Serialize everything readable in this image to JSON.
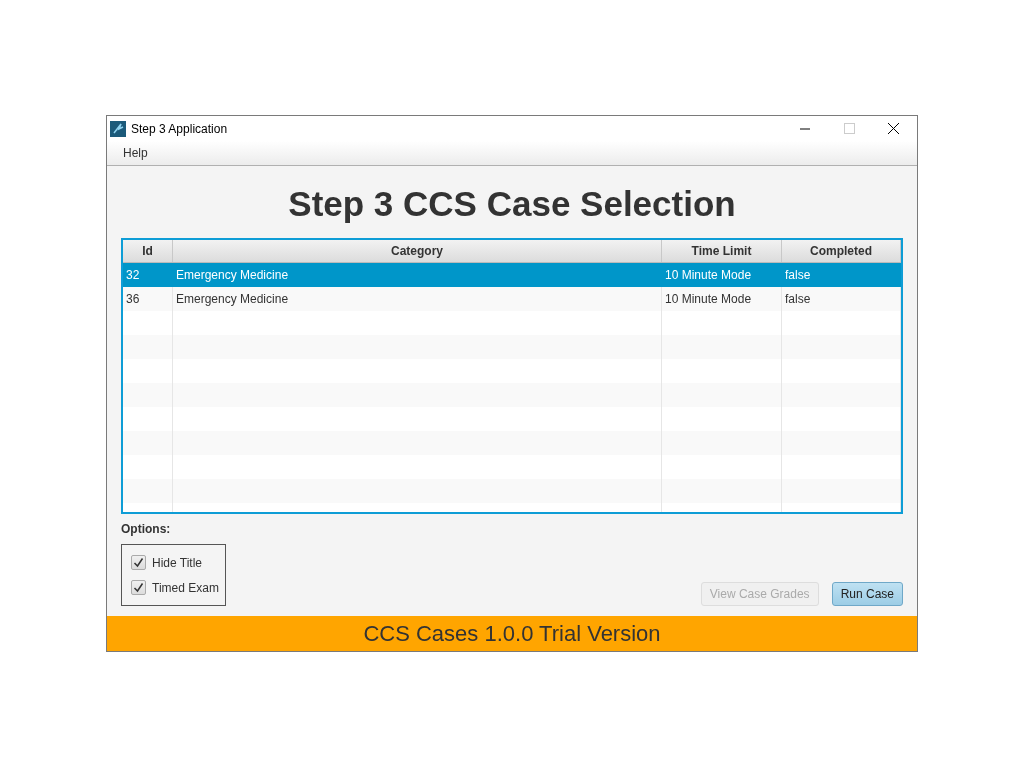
{
  "window": {
    "title": "Step 3 Application"
  },
  "menu": [
    "Help"
  ],
  "heading": "Step 3 CCS Case Selection",
  "table": {
    "columns": [
      "Id",
      "Category",
      "Time Limit",
      "Completed"
    ],
    "rows": [
      {
        "cells": [
          "32",
          "Emergency Medicine",
          "10 Minute Mode",
          "false"
        ],
        "selected": true
      },
      {
        "cells": [
          "36",
          "Emergency Medicine",
          "10 Minute Mode",
          "false"
        ],
        "selected": false
      }
    ]
  },
  "options": {
    "label": "Options:",
    "items": [
      {
        "label": "Hide Title",
        "checked": true
      },
      {
        "label": "Timed Exam",
        "checked": true
      }
    ]
  },
  "buttons": [
    {
      "label": "View Case Grades",
      "disabled": true
    },
    {
      "label": "Run Case",
      "disabled": false
    }
  ],
  "status_bar": "CCS Cases 1.0.0 Trial Version"
}
